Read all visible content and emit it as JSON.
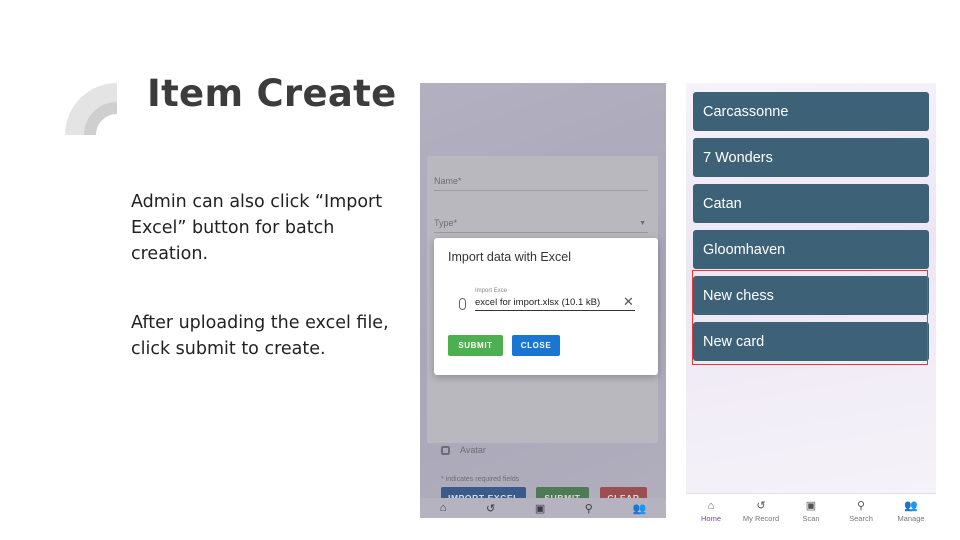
{
  "slide": {
    "title": "Item Create",
    "paragraph1": "Admin can also click “Import Excel” button for batch creation.",
    "paragraph2": "After uploading the excel file, click submit to create."
  },
  "left_screen": {
    "form": {
      "name_label": "Name*",
      "type_label": "Type*",
      "avatar_label": "Avatar",
      "required_note": "* indicates required fields",
      "import_button": "IMPORT EXCEL",
      "submit_button": "SUBMIT",
      "clear_button": "CLEAR"
    },
    "dialog": {
      "title": "Import data with Excel",
      "file_label": "Import Exce",
      "file_value": "excel for import.xlsx (10.1 kB)",
      "submit_button": "SUBMIT",
      "close_button": "CLOSE"
    },
    "nav_icons": [
      "home-icon",
      "history-icon",
      "scan-icon",
      "search-icon",
      "manage-icon"
    ]
  },
  "right_screen": {
    "games": [
      "Carcassonne",
      "7 Wonders",
      "Catan",
      "Gloomhaven",
      "New chess",
      "New card"
    ],
    "highlight_color": "#e53935",
    "nav": [
      {
        "label": "Home",
        "icon": "home-icon",
        "active": true
      },
      {
        "label": "My Record",
        "icon": "history-icon",
        "active": false
      },
      {
        "label": "Scan",
        "icon": "scan-icon",
        "active": false
      },
      {
        "label": "Search",
        "icon": "search-icon",
        "active": false
      },
      {
        "label": "Manage",
        "icon": "manage-icon",
        "active": false
      }
    ],
    "accent_color": "#7b3fb0"
  }
}
